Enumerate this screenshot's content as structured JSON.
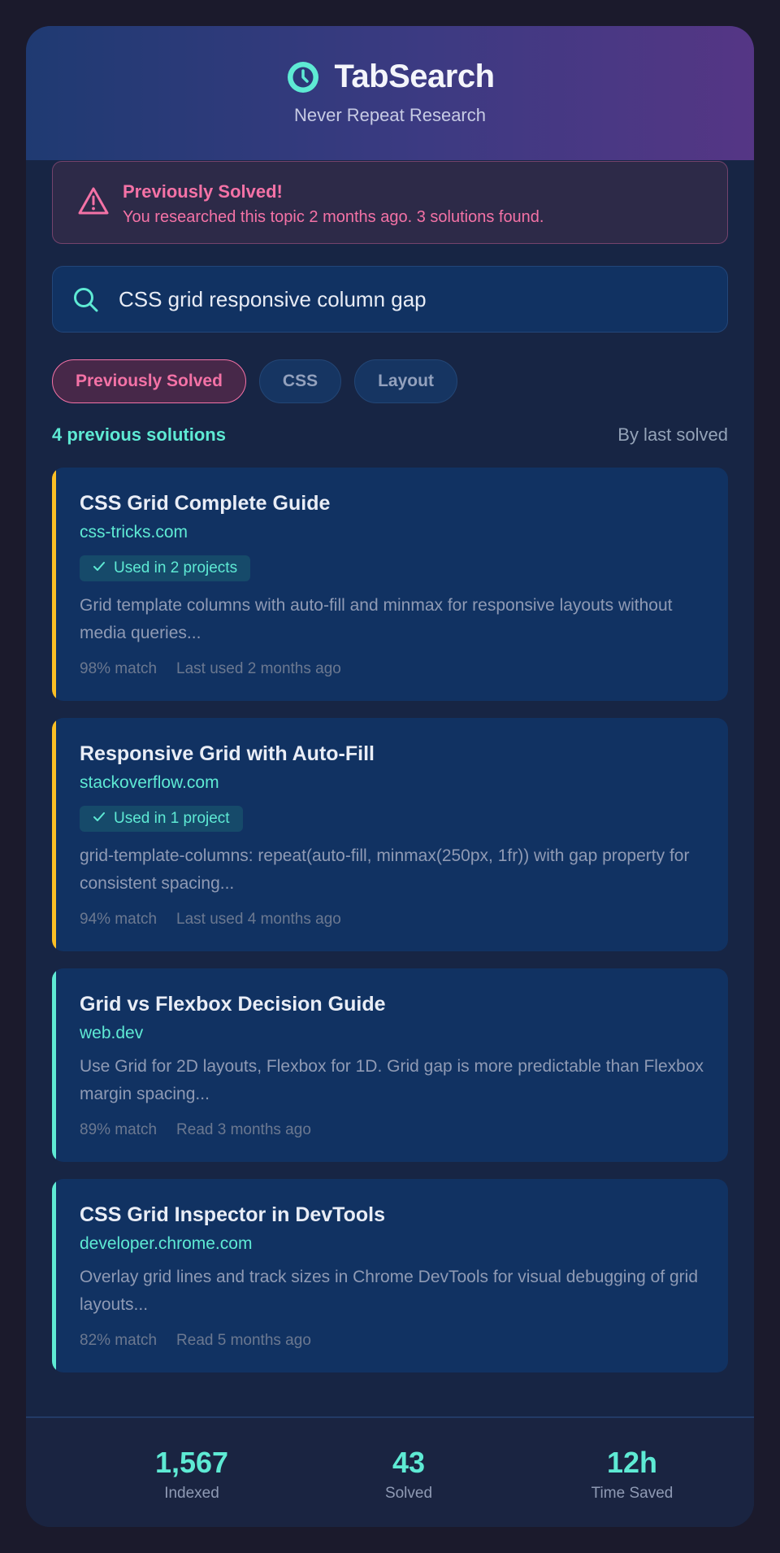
{
  "header": {
    "title": "TabSearch",
    "subtitle": "Never Repeat Research",
    "icon": "clock-icon"
  },
  "alert": {
    "title": "Previously Solved!",
    "message": "You researched this topic 2 months ago. 3 solutions found.",
    "icon": "warning-triangle-icon"
  },
  "search": {
    "value": "CSS grid responsive column gap",
    "icon": "search-icon"
  },
  "filters": [
    {
      "label": "Previously Solved",
      "active": true
    },
    {
      "label": "CSS",
      "active": false
    },
    {
      "label": "Layout",
      "active": false
    }
  ],
  "results": {
    "count_label": "4 previous solutions",
    "sort_label": "By last solved",
    "items": [
      {
        "title": "CSS Grid Complete Guide",
        "domain": "css-tricks.com",
        "badge": "Used in 2 projects",
        "description": "Grid template columns with auto-fill and minmax for responsive layouts without media queries...",
        "match": "98% match",
        "last": "Last used 2 months ago",
        "accent": "#fbbf24"
      },
      {
        "title": "Responsive Grid with Auto-Fill",
        "domain": "stackoverflow.com",
        "badge": "Used in 1 project",
        "description": "grid-template-columns: repeat(auto-fill, minmax(250px, 1fr)) with gap property for consistent spacing...",
        "match": "94% match",
        "last": "Last used 4 months ago",
        "accent": "#fbbf24"
      },
      {
        "title": "Grid vs Flexbox Decision Guide",
        "domain": "web.dev",
        "description": "Use Grid for 2D layouts, Flexbox for 1D. Grid gap is more predictable than Flexbox margin spacing...",
        "match": "89% match",
        "last": "Read 3 months ago",
        "accent": "#5eead4"
      },
      {
        "title": "CSS Grid Inspector in DevTools",
        "domain": "developer.chrome.com",
        "description": "Overlay grid lines and track sizes in Chrome DevTools for visual debugging of grid layouts...",
        "match": "82% match",
        "last": "Read 5 months ago",
        "accent": "#5eead4"
      }
    ]
  },
  "stats": [
    {
      "value": "1,567",
      "label": "Indexed"
    },
    {
      "value": "43",
      "label": "Solved"
    },
    {
      "value": "12h",
      "label": "Time Saved"
    }
  ],
  "colors": {
    "accent_teal": "#5eead4",
    "accent_pink": "#f472a6",
    "accent_amber": "#fbbf24"
  }
}
